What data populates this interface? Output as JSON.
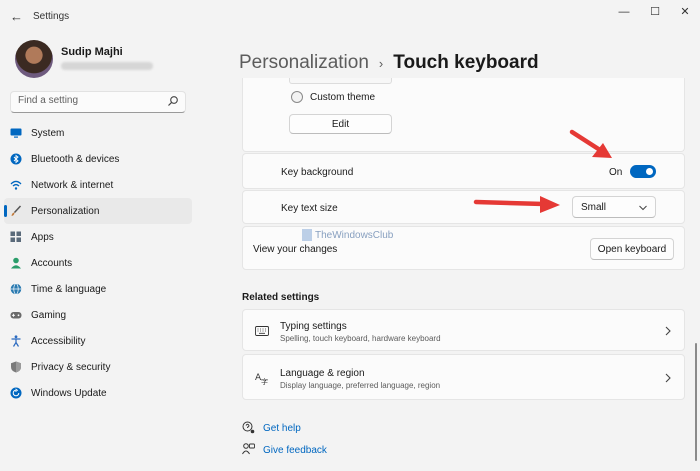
{
  "window": {
    "title": "Settings",
    "controls": {
      "minimize": "—",
      "maximize": "☐",
      "close": "✕"
    }
  },
  "profile": {
    "name": "Sudip Majhi"
  },
  "search": {
    "placeholder": "Find a setting"
  },
  "sidebar": {
    "items": [
      {
        "label": "System",
        "icon": "monitor-icon",
        "color": "#0067c0"
      },
      {
        "label": "Bluetooth & devices",
        "icon": "bluetooth-icon",
        "color": "#0067c0"
      },
      {
        "label": "Network & internet",
        "icon": "wifi-icon",
        "color": "#0067c0"
      },
      {
        "label": "Personalization",
        "icon": "brush-icon",
        "color": "#c27a3a",
        "selected": true
      },
      {
        "label": "Apps",
        "icon": "apps-icon",
        "color": "#5a6a7a"
      },
      {
        "label": "Accounts",
        "icon": "person-icon",
        "color": "#2a9d6a"
      },
      {
        "label": "Time & language",
        "icon": "globe-icon",
        "color": "#2a7ab0"
      },
      {
        "label": "Gaming",
        "icon": "gamepad-icon",
        "color": "#6a6a6a"
      },
      {
        "label": "Accessibility",
        "icon": "accessibility-icon",
        "color": "#2a6ac0"
      },
      {
        "label": "Privacy & security",
        "icon": "shield-icon",
        "color": "#7a7a7a"
      },
      {
        "label": "Windows Update",
        "icon": "update-icon",
        "color": "#0067c0"
      }
    ]
  },
  "header": {
    "parent": "Personalization",
    "separator": "›",
    "current": "Touch keyboard"
  },
  "theme": {
    "custom_theme_label": "Custom theme",
    "edit_label": "Edit"
  },
  "key_background": {
    "label": "Key background",
    "state": "On"
  },
  "key_text_size": {
    "label": "Key text size",
    "value": "Small"
  },
  "view_changes": {
    "label": "View your changes",
    "button": "Open keyboard"
  },
  "watermark": "TheWindowsClub",
  "related": {
    "title": "Related settings",
    "items": [
      {
        "title": "Typing settings",
        "subtitle": "Spelling, touch keyboard, hardware keyboard",
        "icon": "keyboard-icon"
      },
      {
        "title": "Language & region",
        "subtitle": "Display language, preferred language, region",
        "icon": "language-icon"
      }
    ]
  },
  "help": {
    "get_help": "Get help",
    "give_feedback": "Give feedback"
  },
  "colors": {
    "accent": "#0067c0",
    "arrow": "#e53935"
  }
}
